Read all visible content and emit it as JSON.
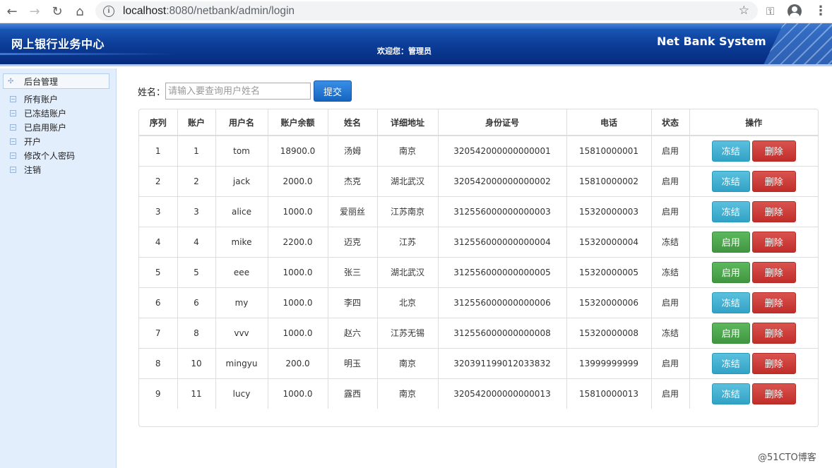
{
  "browser": {
    "url_host": "localhost",
    "url_rest": ":8080/netbank/admin/login"
  },
  "banner": {
    "title": "网上银行业务中心",
    "welcome": "欢迎您：管理员",
    "brand": "Net Bank System"
  },
  "sidebar": {
    "root": "后台管理",
    "items": [
      "所有账户",
      "已冻结账户",
      "已启用账户",
      "开户",
      "修改个人密码",
      "注销"
    ]
  },
  "search": {
    "label": "姓名：",
    "placeholder": "请输入要查询用户姓名",
    "submit": "提交"
  },
  "table": {
    "headers": [
      "序列",
      "账户",
      "用户名",
      "账户余额",
      "姓名",
      "详细地址",
      "身份证号",
      "电话",
      "状态",
      "操作"
    ],
    "rows": [
      {
        "seq": "1",
        "account": "1",
        "username": "tom",
        "balance": "18900.0",
        "name": "汤姆",
        "address": "南京",
        "id_no": "320542000000000001",
        "phone": "15810000001",
        "status": "启用",
        "action": "冻结"
      },
      {
        "seq": "2",
        "account": "2",
        "username": "jack",
        "balance": "2000.0",
        "name": "杰克",
        "address": "湖北武汉",
        "id_no": "320542000000000002",
        "phone": "15810000002",
        "status": "启用",
        "action": "冻结"
      },
      {
        "seq": "3",
        "account": "3",
        "username": "alice",
        "balance": "1000.0",
        "name": "爱丽丝",
        "address": "江苏南京",
        "id_no": "312556000000000003",
        "phone": "15320000003",
        "status": "启用",
        "action": "冻结"
      },
      {
        "seq": "4",
        "account": "4",
        "username": "mike",
        "balance": "2200.0",
        "name": "迈克",
        "address": "江苏",
        "id_no": "312556000000000004",
        "phone": "15320000004",
        "status": "冻结",
        "action": "启用"
      },
      {
        "seq": "5",
        "account": "5",
        "username": "eee",
        "balance": "1000.0",
        "name": "张三",
        "address": "湖北武汉",
        "id_no": "312556000000000005",
        "phone": "15320000005",
        "status": "冻结",
        "action": "启用"
      },
      {
        "seq": "6",
        "account": "6",
        "username": "my",
        "balance": "1000.0",
        "name": "李四",
        "address": "北京",
        "id_no": "312556000000000006",
        "phone": "15320000006",
        "status": "启用",
        "action": "冻结"
      },
      {
        "seq": "7",
        "account": "8",
        "username": "vvv",
        "balance": "1000.0",
        "name": "赵六",
        "address": "江苏无锡",
        "id_no": "312556000000000008",
        "phone": "15320000008",
        "status": "冻结",
        "action": "启用"
      },
      {
        "seq": "8",
        "account": "10",
        "username": "mingyu",
        "balance": "200.0",
        "name": "明玉",
        "address": "南京",
        "id_no": "320391199012033832",
        "phone": "13999999999",
        "status": "启用",
        "action": "冻结"
      },
      {
        "seq": "9",
        "account": "11",
        "username": "lucy",
        "balance": "1000.0",
        "name": "露西",
        "address": "南京",
        "id_no": "320542000000000013",
        "phone": "15810000013",
        "status": "启用",
        "action": "冻结"
      }
    ],
    "delete_label": "删除"
  },
  "watermark": "@51CTO博客"
}
